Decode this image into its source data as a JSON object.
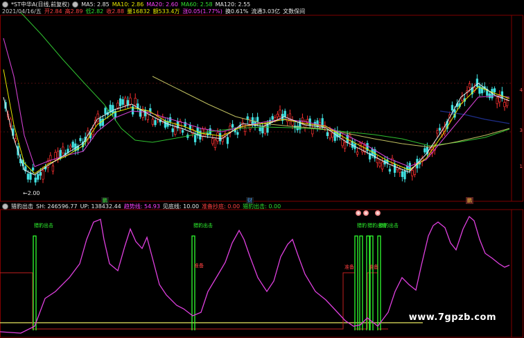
{
  "header": {
    "title": "*ST中华A(日线,前复权)",
    "ma": [
      {
        "label": "MA5: 2.85",
        "color": "#e8e8e8"
      },
      {
        "label": "MA10: 2.86",
        "color": "#e8e800"
      },
      {
        "label": "MA20: 2.60",
        "color": "#ff40ff"
      },
      {
        "label": "MA60: 2.58",
        "color": "#30e030"
      },
      {
        "label": "MA120: 2.55",
        "color": "#e8e8e8"
      }
    ],
    "info": [
      {
        "label": "2021/04/16/五",
        "color": "#ccc"
      },
      {
        "label": "开2.84",
        "color": "#ff4040"
      },
      {
        "label": "高2.89",
        "color": "#ff4040"
      },
      {
        "label": "低2.82",
        "color": "#30e030"
      },
      {
        "label": "收2.88",
        "color": "#ff4040"
      },
      {
        "label": "量16832",
        "color": "#e8e800"
      },
      {
        "label": "额533.4万",
        "color": "#e8e800"
      },
      {
        "label": "涨0.05(1.77%)",
        "color": "#ff40ff"
      },
      {
        "label": "换0.61%",
        "color": "#e8e8e8"
      },
      {
        "label": "流通3.03亿",
        "color": "#e8e8e8"
      },
      {
        "label": "文数保间",
        "color": "#e8e8e8"
      }
    ],
    "low_label": "←2.00",
    "tag_left": "鹏",
    "tag_mid": "财",
    "tag_right": "鹏"
  },
  "indicator": {
    "items": [
      {
        "label": "猎豹出击",
        "color": "#e8e8e8"
      },
      {
        "label": "SH: 246596.77",
        "color": "#e8e8e8"
      },
      {
        "label": "UP: 138432.44",
        "color": "#e8e8e8"
      },
      {
        "label": "趋势线: 54.93",
        "color": "#ff40ff"
      },
      {
        "label": "见底线: 10.00",
        "color": "#e8e8e8"
      },
      {
        "label": "准备抄底: 0.00",
        "color": "#ff4040"
      },
      {
        "label": "猎豹出击: 0.00",
        "color": "#30e030"
      }
    ],
    "signals": [
      "猎豹出击",
      "猎豹出击",
      "猎豹",
      "猎豹出击",
      "猎豹出击"
    ],
    "marks": [
      "准备",
      "准备",
      "准备"
    ]
  },
  "watermark": "www.7gpzb.com",
  "chart_data": {
    "type": "line",
    "title": "*ST中华A(日线,前复权)",
    "series": [
      {
        "name": "MA5",
        "last": 2.85
      },
      {
        "name": "MA10",
        "last": 2.86
      },
      {
        "name": "MA20",
        "last": 2.6
      },
      {
        "name": "MA60",
        "last": 2.58
      },
      {
        "name": "MA120",
        "last": 2.55
      },
      {
        "name": "趋势线",
        "last": 54.93
      },
      {
        "name": "见底线",
        "last": 10.0
      }
    ],
    "low_marker": 2.0,
    "y_ticks_main": [
      "4",
      "3",
      "1"
    ]
  }
}
